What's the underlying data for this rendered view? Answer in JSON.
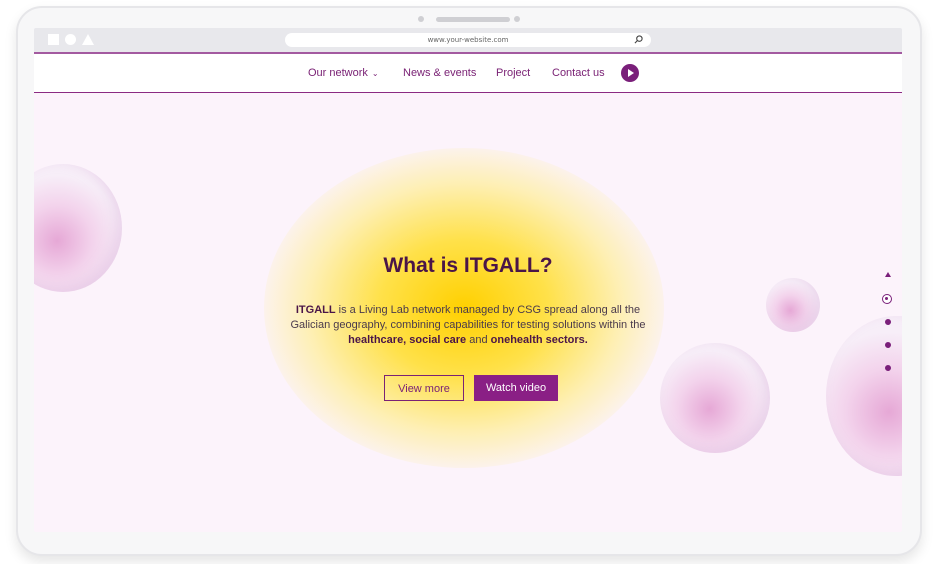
{
  "browser": {
    "url": "www.your-website.com"
  },
  "nav": {
    "items": [
      {
        "label": "Our network",
        "has_dropdown": true
      },
      {
        "label": "News & events"
      },
      {
        "label": "Project"
      },
      {
        "label": "Contact us"
      }
    ]
  },
  "hero": {
    "title": "What is ITGALL?",
    "desc_bold_1": "ITGALL",
    "desc_text_1": " is a Living Lab network managed by CSG spread along all the Galician geography, combining capabilities for testing solutions within the ",
    "desc_bold_2": "healthcare, social care",
    "desc_text_2": " and ",
    "desc_bold_3": "onehealth sectors.",
    "view_more": "View more",
    "watch_video": "Watch video"
  },
  "pagination": {
    "active_index": 0,
    "count": 4
  },
  "colors": {
    "accent": "#7a1f7a",
    "background": "#fcf3fb",
    "glow": "#ffd000"
  }
}
